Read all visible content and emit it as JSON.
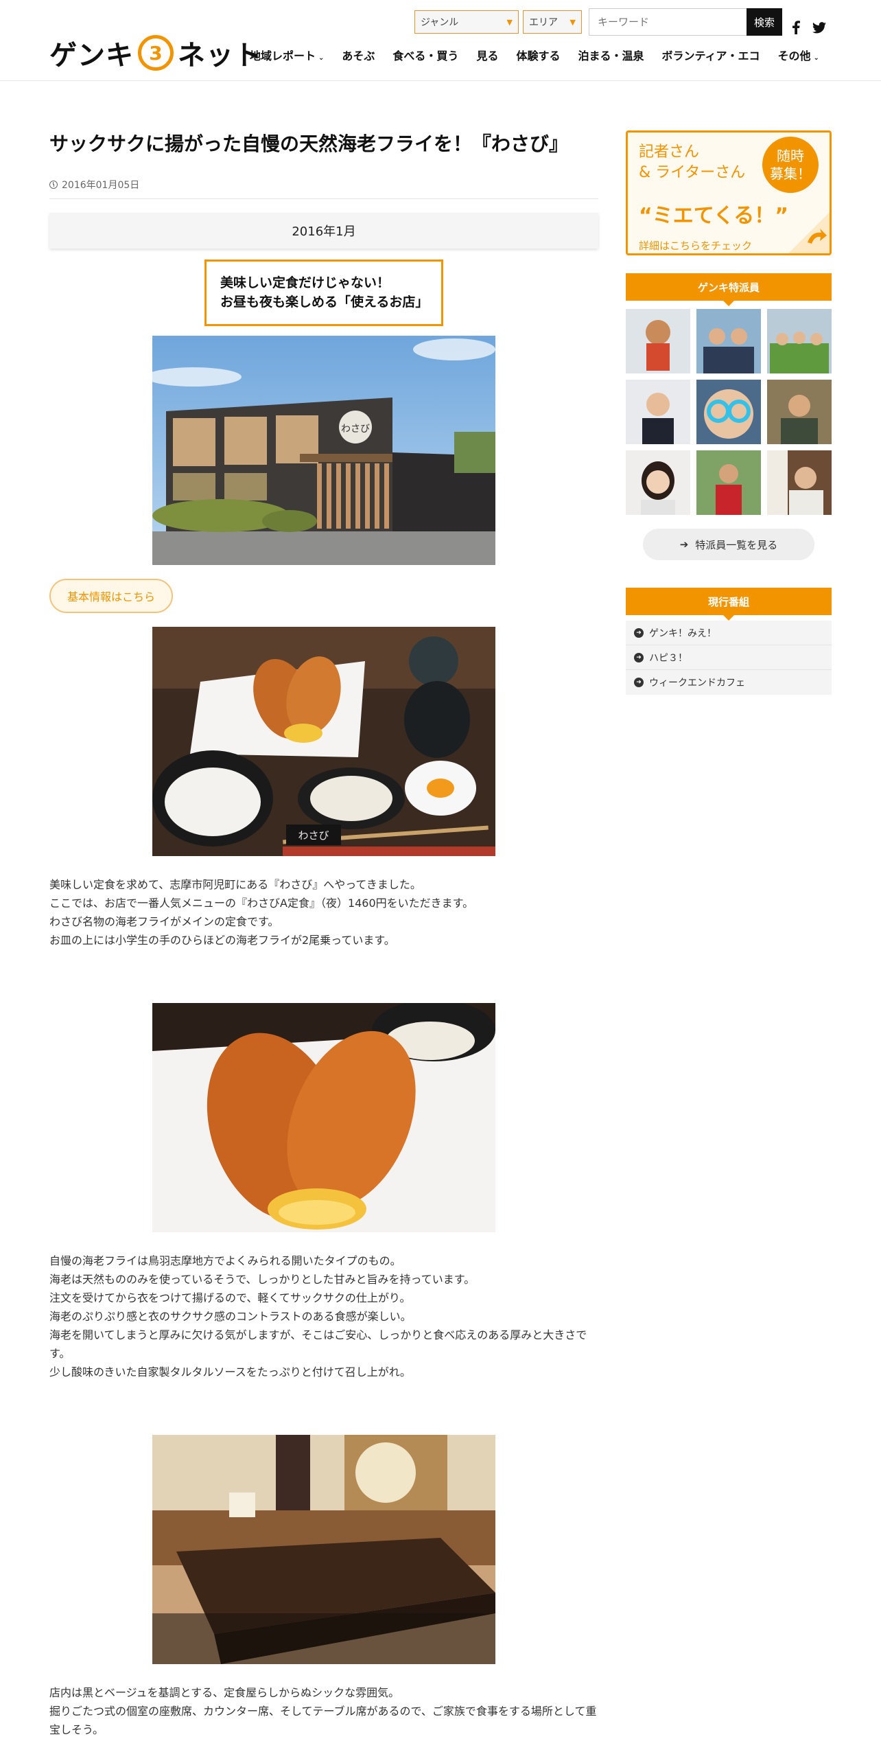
{
  "header": {
    "logo_left": "ゲンキ",
    "logo_mid": "3",
    "logo_right": "ネット",
    "genre_select": "ジャンル",
    "area_select": "エリア",
    "keyword_placeholder": "キーワード",
    "search_label": "検索",
    "sns": {
      "facebook": "f",
      "twitter": "t"
    },
    "nav": [
      {
        "label": "地域レポート",
        "has_menu": true
      },
      {
        "label": "あそぶ",
        "has_menu": false
      },
      {
        "label": "食べる・買う",
        "has_menu": false
      },
      {
        "label": "見る",
        "has_menu": false
      },
      {
        "label": "体験する",
        "has_menu": false
      },
      {
        "label": "泊まる・温泉",
        "has_menu": false
      },
      {
        "label": "ボランティア・エコ",
        "has_menu": false
      },
      {
        "label": "その他",
        "has_menu": true
      }
    ]
  },
  "article": {
    "title": "サックサクに揚がった自慢の天然海老フライを！『わさび』",
    "date": "2016年01月05日",
    "month_label": "2016年1月",
    "catch_line1": "美味しい定食だけじゃない！",
    "catch_line2": "お昼も夜も楽しめる「使えるお店」",
    "info_button": "基本情報はこちら",
    "paragraph1": [
      "美味しい定食を求めて、志摩市阿児町にある『わさび』へやってきました。",
      "ここでは、お店で一番人気メニューの『わさびA定食』（夜）1460円をいただきます。",
      "わさび名物の海老フライがメインの定食です。",
      "お皿の上には小学生の手のひらほどの海老フライが2尾乗っています。"
    ],
    "paragraph2": [
      "自慢の海老フライは鳥羽志摩地方でよくみられる開いたタイプのもの。",
      "海老は天然もののみを使っているそうで、しっかりとした甘みと旨みを持っています。",
      "注文を受けてから衣をつけて揚げるので、軽くてサックサクの仕上がり。",
      "海老のぷりぷり感と衣のサクサク感のコントラストのある食感が楽しい。",
      "海老を開いてしまうと厚みに欠ける気がしますが、そこはご安心、しっかりと食べ応えのある厚みと大きさで",
      "す。",
      "少し酸味のきいた自家製タルタルソースをたっぷりと付けて召し上がれ。"
    ],
    "paragraph3": [
      "店内は黒とベージュを基調とする、定食屋らしからぬシックな雰囲気。",
      "掘りごたつ式の個室の座敷席、カウンター席、そしてテーブル席があるので、ご家族で食事をする場所として重",
      "宝しそう。"
    ],
    "shop_sign": "わさび"
  },
  "sidebar": {
    "banner_line1": "記者さん",
    "banner_line2": "& ライターさん",
    "banner_badge1": "随時",
    "banner_badge2": "募集！",
    "banner_main": "“ミエてくる！”",
    "banner_link": "詳細はこちらをチェック",
    "reporters_heading": "ゲンキ特派員",
    "reporters_button": "特派員一覧を見る",
    "programs_heading": "現行番組",
    "programs": [
      "ゲンキ！みえ！",
      "ハピ３！",
      "ウィークエンドカフェ"
    ]
  },
  "colors": {
    "accent": "#f29400",
    "text": "#222222",
    "nav_bg": "#ffffff"
  }
}
